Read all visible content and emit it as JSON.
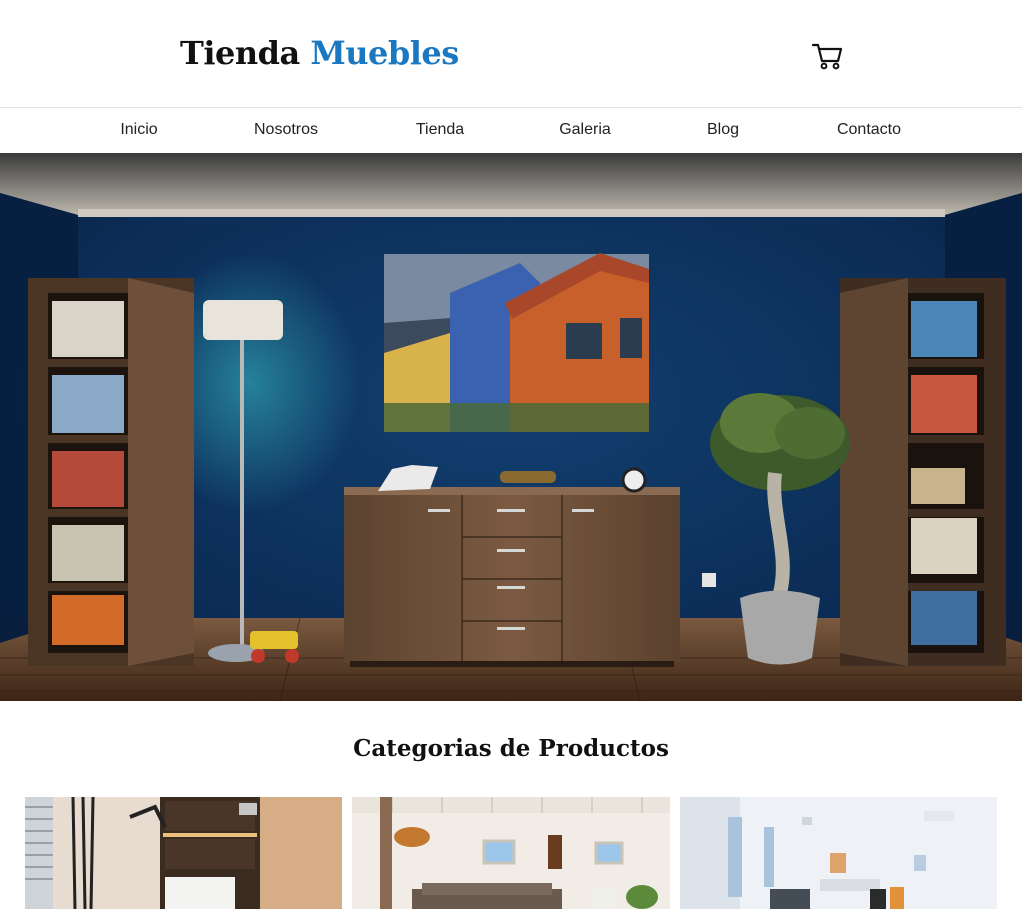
{
  "brand": {
    "name_part1": "Tienda",
    "name_part2": "Muebles",
    "accent_color": "#1a78c2"
  },
  "header": {
    "cart_icon": "shopping-cart-icon"
  },
  "nav": {
    "items": [
      {
        "label": "Inicio"
      },
      {
        "label": "Nosotros"
      },
      {
        "label": "Tienda"
      },
      {
        "label": "Galeria"
      },
      {
        "label": "Blog"
      },
      {
        "label": "Contacto"
      }
    ]
  },
  "categories": {
    "title": "Categorias de Productos"
  }
}
